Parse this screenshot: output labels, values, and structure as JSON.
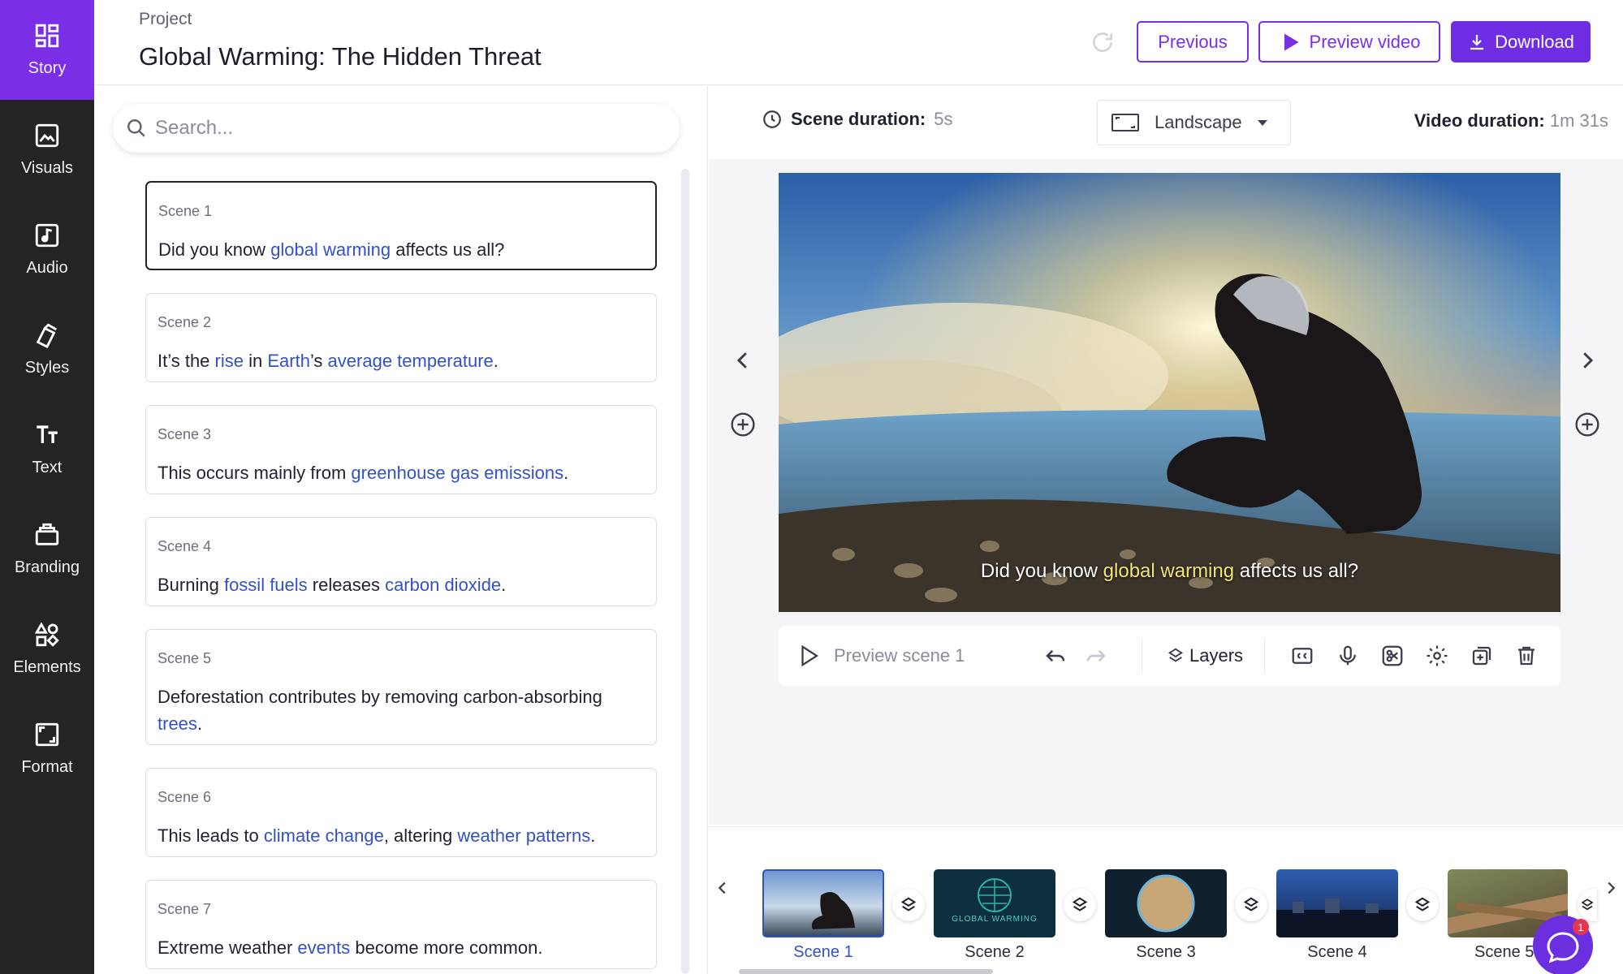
{
  "nav": {
    "items": [
      {
        "label": "Story",
        "icon": "story-grid-icon",
        "active": true
      },
      {
        "label": "Visuals",
        "icon": "image-icon"
      },
      {
        "label": "Audio",
        "icon": "music-note-icon"
      },
      {
        "label": "Styles",
        "icon": "cards-icon"
      },
      {
        "label": "Text",
        "icon": "text-icon"
      },
      {
        "label": "Branding",
        "icon": "briefcase-icon"
      },
      {
        "label": "Elements",
        "icon": "shapes-icon"
      },
      {
        "label": "Format",
        "icon": "aspect-ratio-icon"
      }
    ]
  },
  "header": {
    "project_label": "Project",
    "title": "Global Warming: The Hidden Threat",
    "previous_label": "Previous",
    "preview_label": "Preview video",
    "download_label": "Download"
  },
  "search": {
    "placeholder": "Search..."
  },
  "scenes": [
    {
      "label": "Scene 1",
      "parts": [
        {
          "t": "Did you know "
        },
        {
          "t": "global warming",
          "kw": true
        },
        {
          "t": " affects us all?"
        }
      ]
    },
    {
      "label": "Scene 2",
      "parts": [
        {
          "t": "It’s the "
        },
        {
          "t": "rise",
          "kw": true
        },
        {
          "t": " in "
        },
        {
          "t": "Earth",
          "kw": true
        },
        {
          "t": "’s "
        },
        {
          "t": "average temperature",
          "kw": true
        },
        {
          "t": "."
        }
      ]
    },
    {
      "label": "Scene 3",
      "parts": [
        {
          "t": "This occurs mainly from "
        },
        {
          "t": "greenhouse gas emissions",
          "kw": true
        },
        {
          "t": "."
        }
      ]
    },
    {
      "label": "Scene 4",
      "parts": [
        {
          "t": "Burning "
        },
        {
          "t": "fossil fuels",
          "kw": true
        },
        {
          "t": " releases "
        },
        {
          "t": "carbon dioxide",
          "kw": true
        },
        {
          "t": "."
        }
      ]
    },
    {
      "label": "Scene 5",
      "parts": [
        {
          "t": "Deforestation contributes by removing carbon-absorbing "
        },
        {
          "t": "trees",
          "kw": true
        },
        {
          "t": "."
        }
      ]
    },
    {
      "label": "Scene 6",
      "parts": [
        {
          "t": "This leads to "
        },
        {
          "t": "climate change",
          "kw": true
        },
        {
          "t": ", altering "
        },
        {
          "t": "weather patterns",
          "kw": true
        },
        {
          "t": "."
        }
      ]
    },
    {
      "label": "Scene 7",
      "parts": [
        {
          "t": "Extreme weather "
        },
        {
          "t": "events",
          "kw": true
        },
        {
          "t": " become more common."
        }
      ]
    }
  ],
  "editor": {
    "scene_duration_label": "Scene duration:",
    "scene_duration_value": "5s",
    "orientation": "Landscape",
    "video_duration_label": "Video duration:",
    "video_duration_value": "1m 31s",
    "caption_pre": "Did you know ",
    "caption_kw": "global warming",
    "caption_post": " affects us all?",
    "preview_scene_label": "Preview scene 1",
    "layers_label": "Layers"
  },
  "timeline": {
    "thumbs": [
      {
        "label": "Scene 1",
        "active": true,
        "bg": "#4f76b3"
      },
      {
        "label": "Scene 2",
        "bg": "#0e2f3d",
        "text": "GLOBAL WARMING"
      },
      {
        "label": "Scene 3",
        "bg": "#10202c"
      },
      {
        "label": "Scene 4",
        "bg": "#1d3a78"
      },
      {
        "label": "Scene 5",
        "bg": "#6f6a50"
      }
    ]
  },
  "chat": {
    "badge": "1"
  },
  "colors": {
    "accent": "#7a2ee6",
    "keyword": "#3451c4",
    "nav_bg": "#242424"
  }
}
